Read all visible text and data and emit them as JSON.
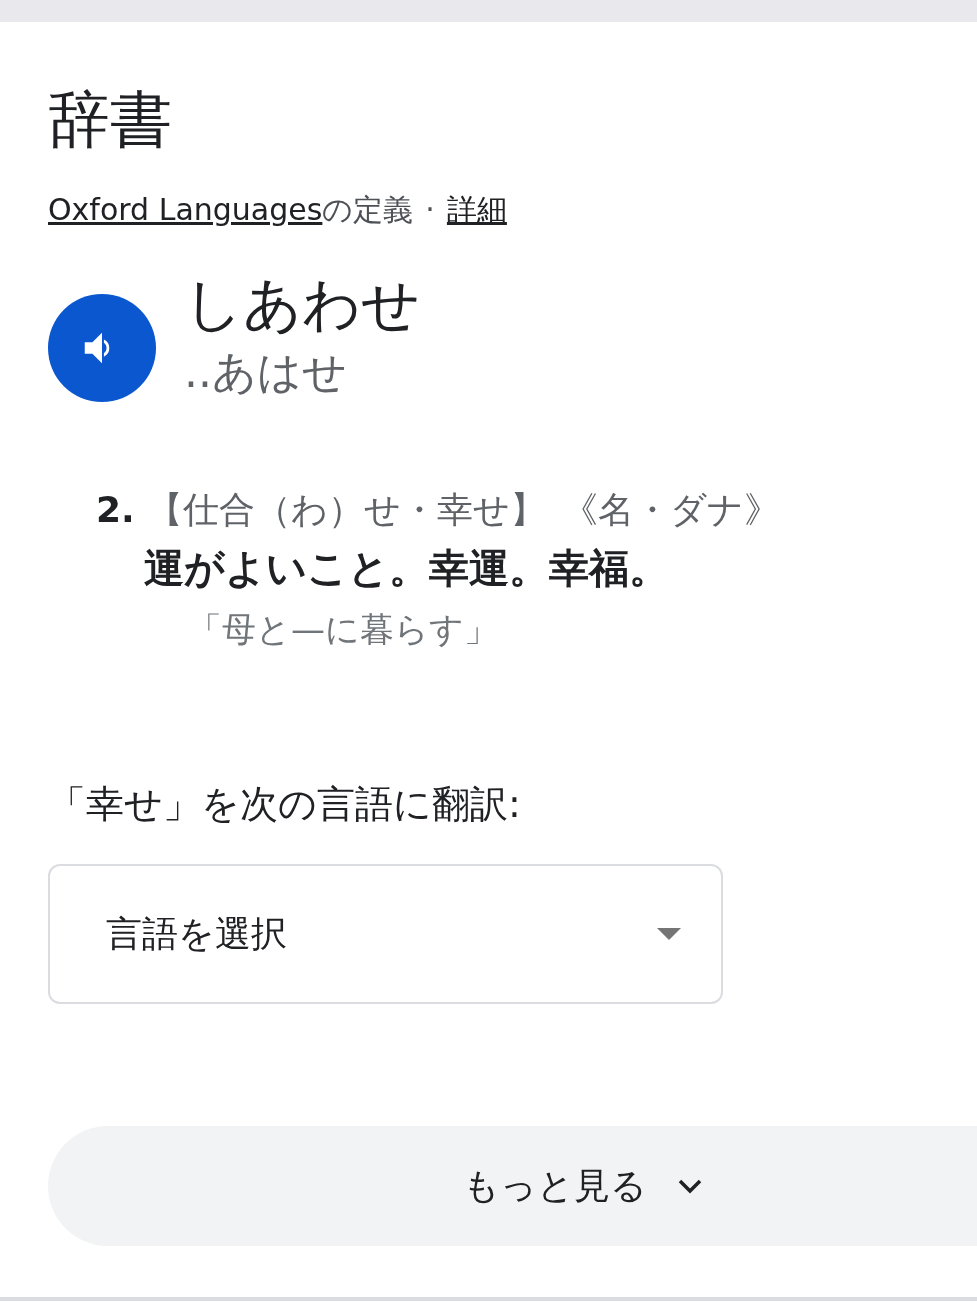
{
  "header": {
    "title": "辞書"
  },
  "source": {
    "provider_link": "Oxford Languages",
    "suffix": "の定義",
    "separator": "·",
    "details_link": "詳細"
  },
  "entry": {
    "headword": "しあわせ",
    "pronunciation": "..あはせ"
  },
  "senses": [
    {
      "number": "2.",
      "forms": "【仕合（わ）せ・幸せ】",
      "grammar": "《名・ダナ》",
      "definition": "運がよいこと。幸運。幸福。",
      "example": "「母と—に暮らす」"
    }
  ],
  "translate": {
    "label": "「幸せ」を次の言語に翻訳:",
    "select": {
      "placeholder": "言語を選択"
    }
  },
  "more_button": {
    "label": "もっと見る"
  }
}
